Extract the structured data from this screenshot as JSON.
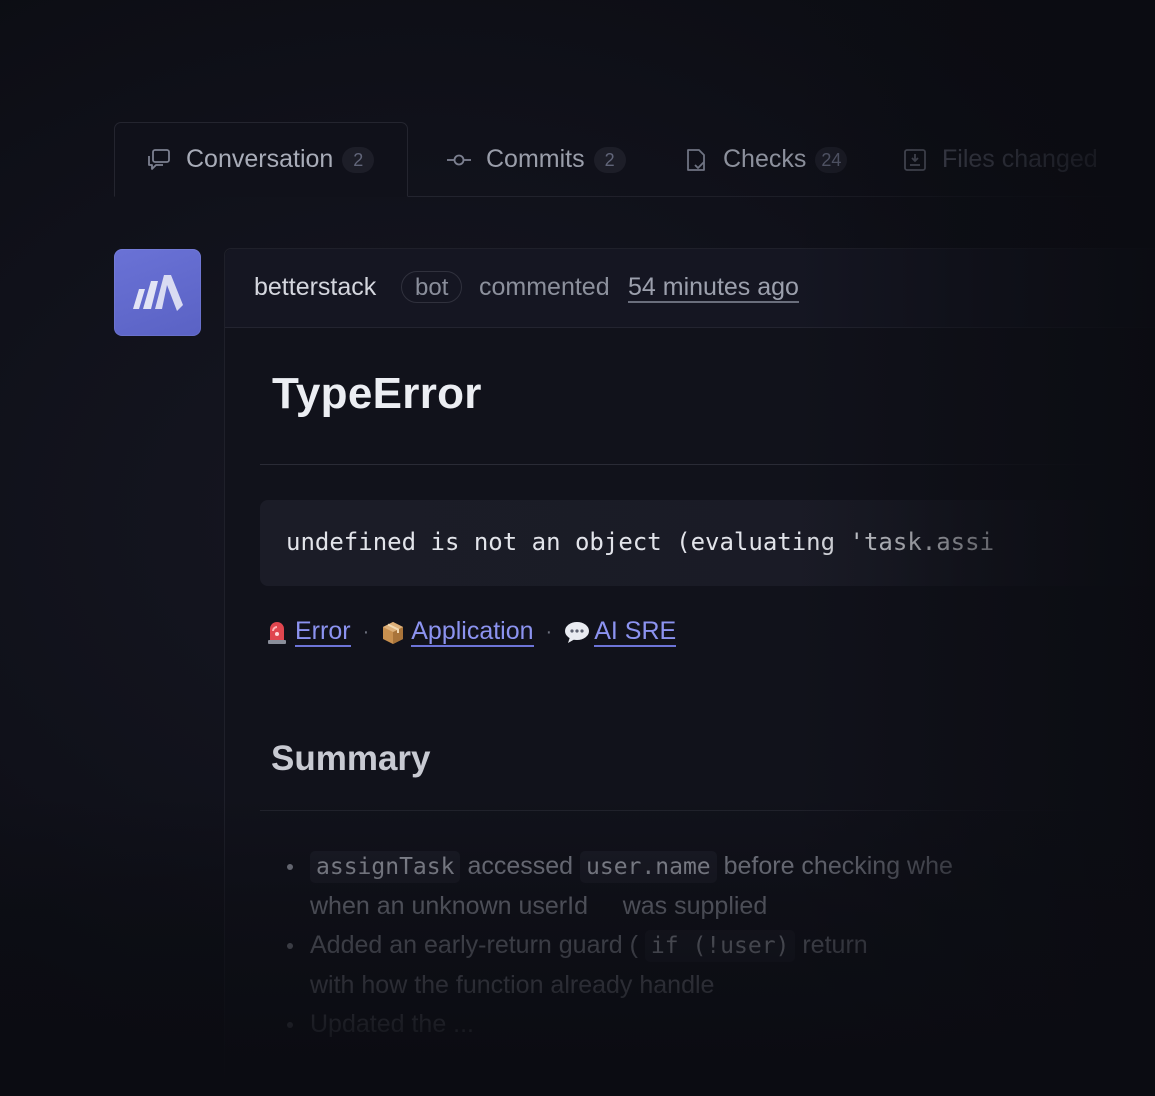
{
  "tabs": [
    {
      "label": "Conversation",
      "count": "2",
      "icon": "conversation-icon",
      "active": true
    },
    {
      "label": "Commits",
      "count": "2",
      "icon": "commit-icon",
      "active": false
    },
    {
      "label": "Checks",
      "count": "24",
      "icon": "checks-icon",
      "active": false
    },
    {
      "label": "Files changed",
      "count": "",
      "icon": "file-diff-icon",
      "active": false
    }
  ],
  "comment": {
    "author": "betterstack",
    "badge": "bot",
    "action": "commented",
    "time": "54 minutes ago",
    "avatar_color": "#6169d1",
    "title": "TypeError",
    "error_message": "undefined is not an object (evaluating 'task.assi",
    "links": [
      {
        "emoji": "siren-icon",
        "label": "Error"
      },
      {
        "emoji": "package-icon",
        "label": "Application"
      },
      {
        "emoji": "speech-bubble-icon",
        "label": "AI SRE"
      }
    ],
    "link_separator": "·",
    "summary_title": "Summary",
    "summary": {
      "b1_code1": "assignTask",
      "b1_text1": "accessed",
      "b1_code2": "user.name",
      "b1_text2": "before checking whe",
      "b1_line2": "when an unknown userId",
      "b1_line2b": "was supplied",
      "b2_text1": "Added an early-return guard (",
      "b2_code1": "if (!user)",
      "b2_text2": "return",
      "b2_line2": "with how the function already handle",
      "b3_text1": "Updated the ..."
    }
  },
  "colors": {
    "accent_link": "#8c93f0",
    "background": "#0c0d14",
    "panel": "#11121b"
  }
}
